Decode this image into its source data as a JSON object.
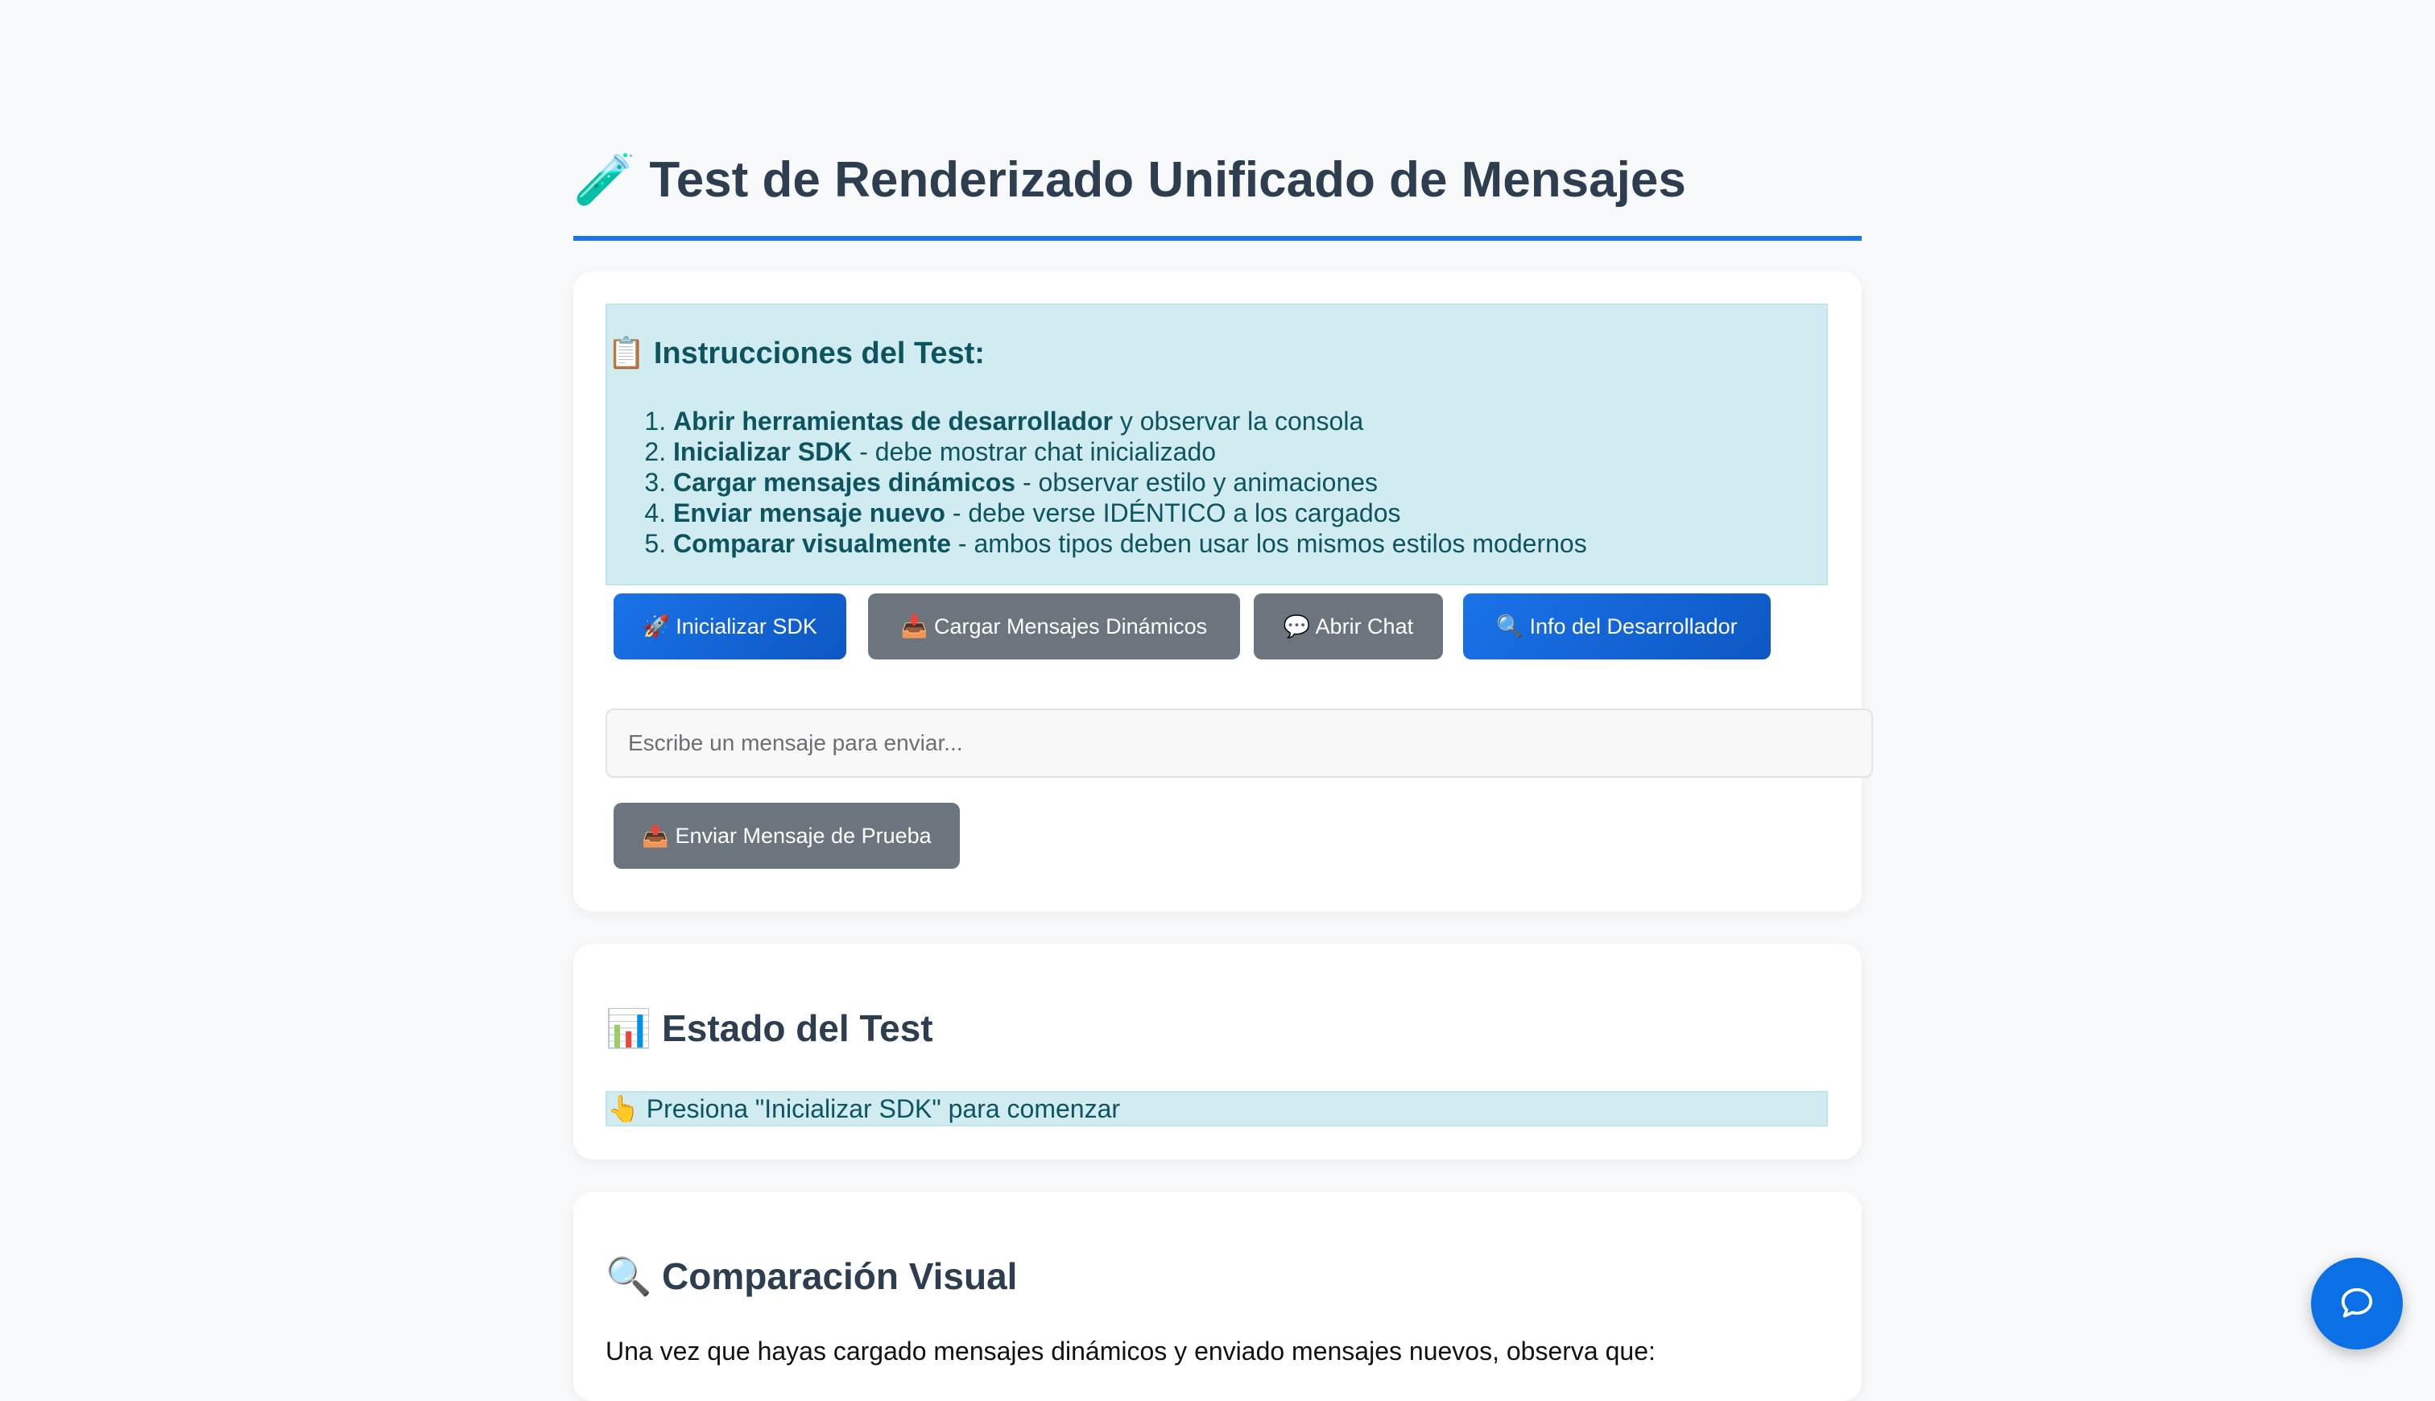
{
  "page": {
    "title": "🧪 Test de Renderizado Unificado de Mensajes"
  },
  "instructions": {
    "heading": "📋 Instrucciones del Test:",
    "steps": [
      {
        "bold": "Abrir herramientas de desarrollador",
        "rest": " y observar la consola"
      },
      {
        "bold": "Inicializar SDK",
        "rest": " - debe mostrar chat inicializado"
      },
      {
        "bold": "Cargar mensajes dinámicos",
        "rest": " - observar estilo y animaciones"
      },
      {
        "bold": "Enviar mensaje nuevo",
        "rest": " - debe verse IDÉNTICO a los cargados"
      },
      {
        "bold": "Comparar visualmente",
        "rest": " - ambos tipos deben usar los mismos estilos modernos"
      }
    ]
  },
  "buttons": {
    "init_sdk": "🚀 Inicializar SDK",
    "load_messages": "📥 Cargar Mensajes Dinámicos",
    "open_chat": "💬 Abrir Chat",
    "dev_info": "🔍 Info del Desarrollador",
    "send_test": "📤 Enviar Mensaje de Prueba"
  },
  "message_input": {
    "placeholder": "Escribe un mensaje para enviar..."
  },
  "status": {
    "heading": "📊 Estado del Test",
    "message": "👆 Presiona \"Inicializar SDK\" para comenzar"
  },
  "comparison": {
    "heading": "🔍 Comparación Visual",
    "intro": "Una vez que hayas cargado mensajes dinámicos y enviado mensajes nuevos, observa que:"
  },
  "chat_fab": {
    "icon": "chat-bubble-icon"
  },
  "colors": {
    "accent": "#1a73e8",
    "info_bg": "#d1ecf1",
    "info_text": "#0c5460",
    "secondary": "#6c757d"
  }
}
